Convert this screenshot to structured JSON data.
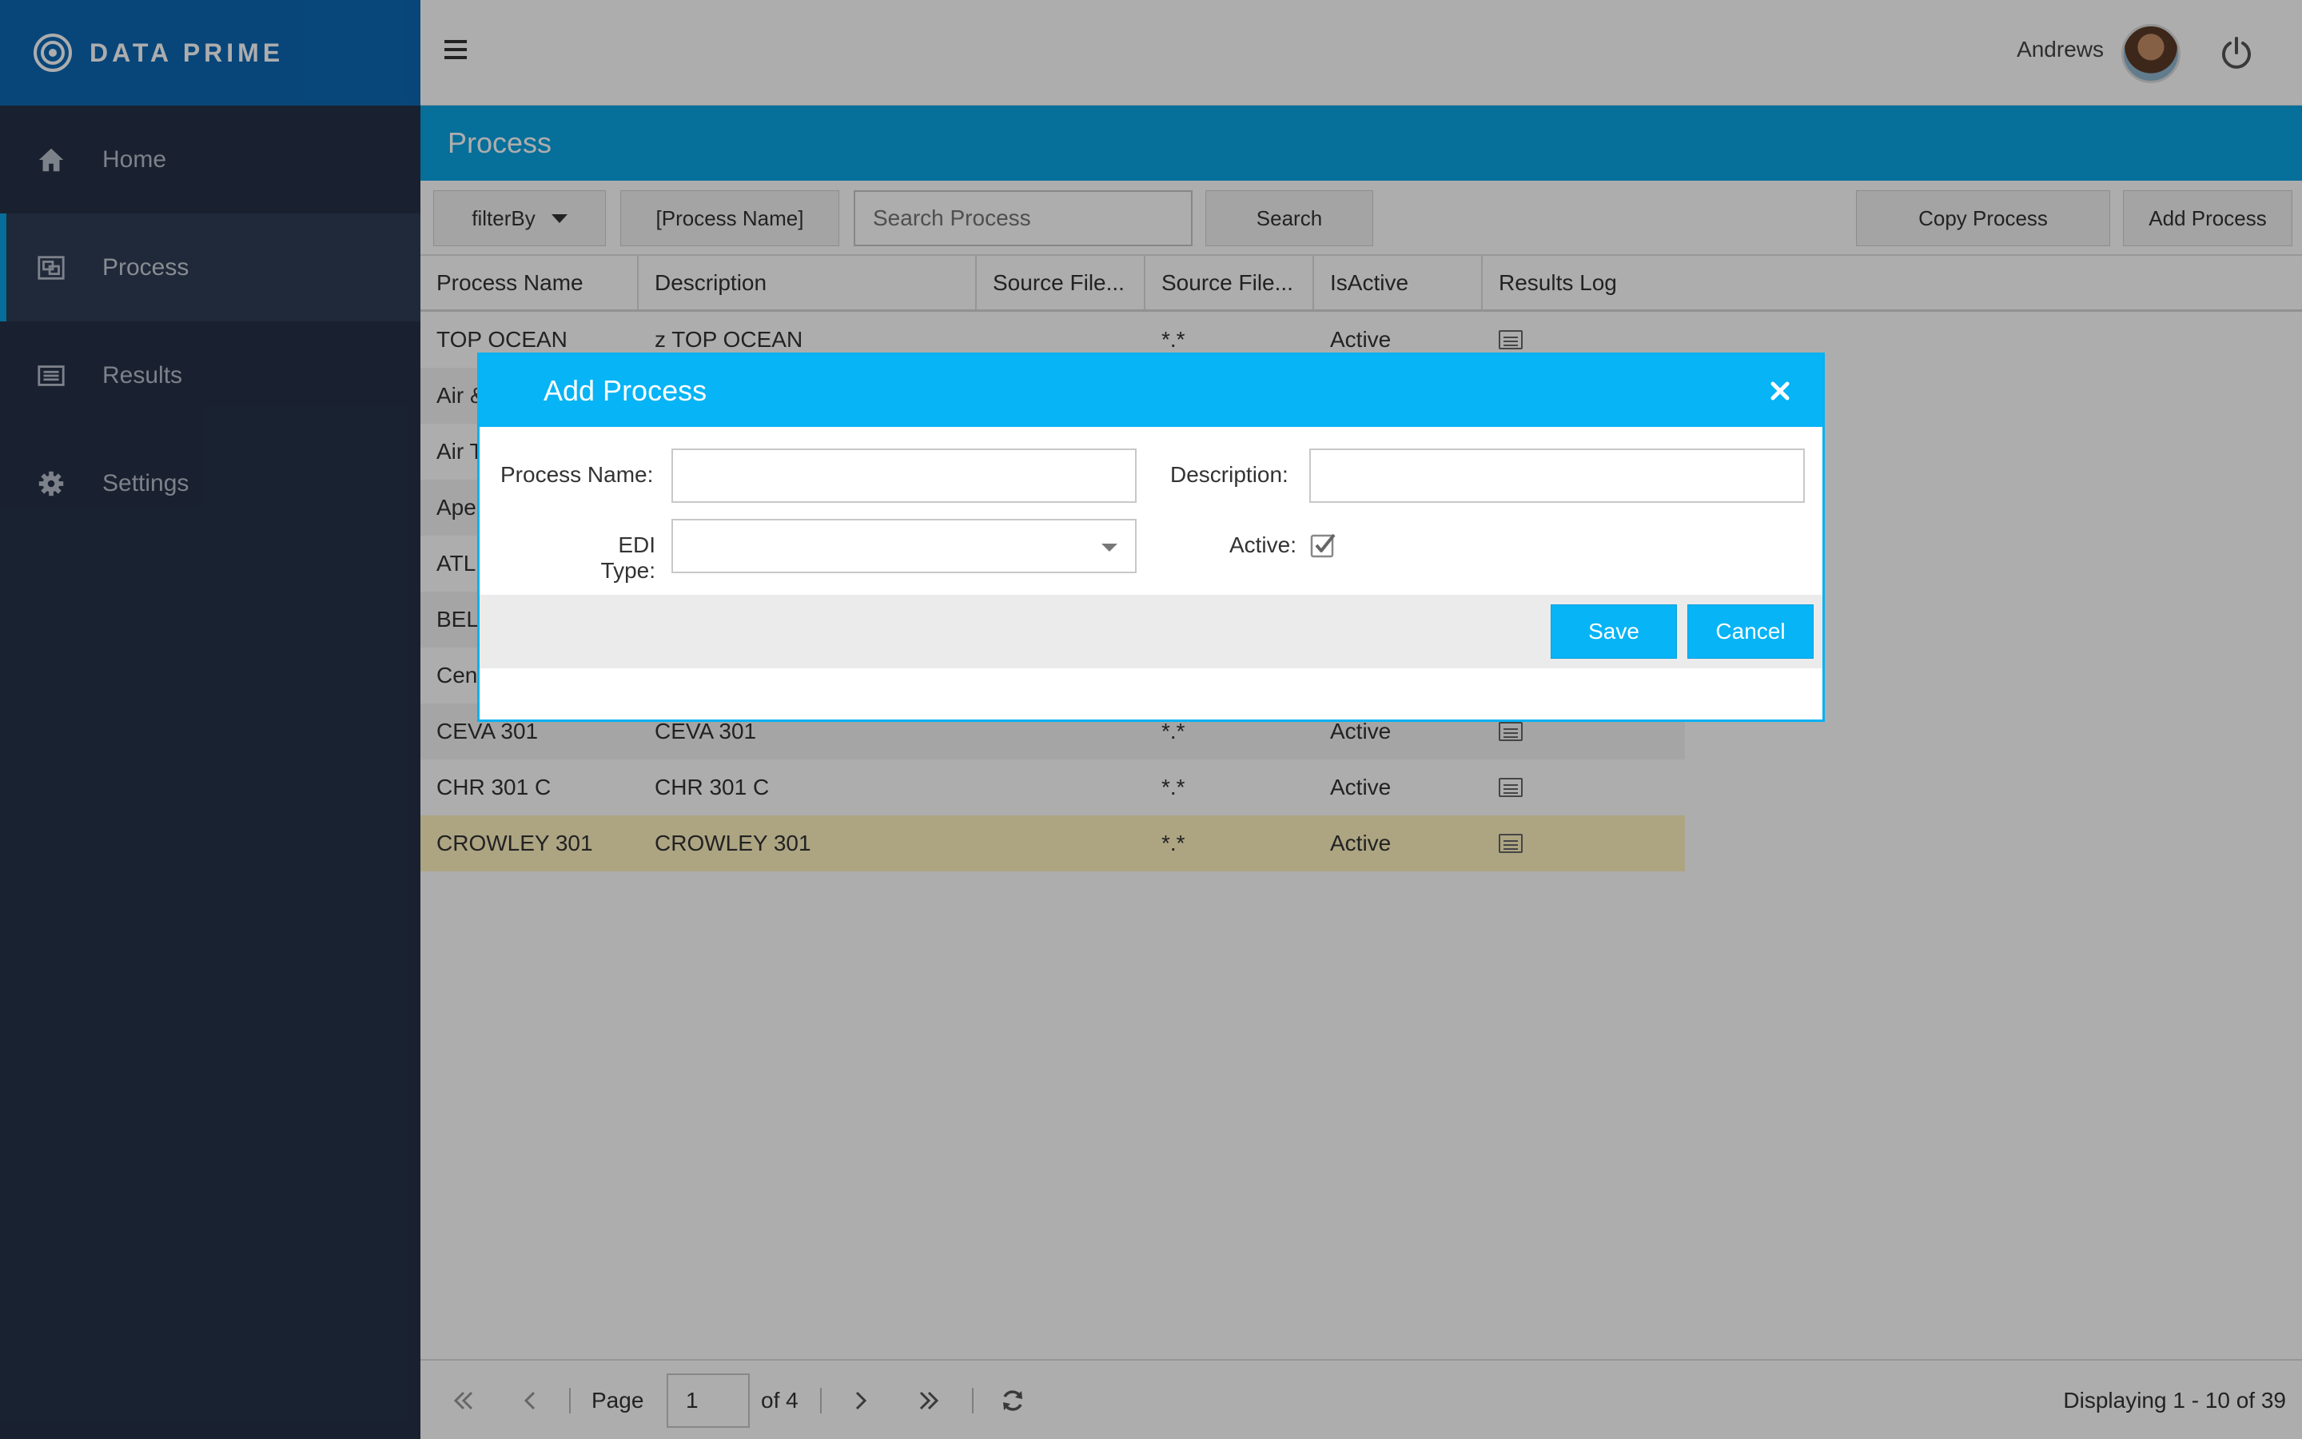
{
  "brand": {
    "name": "DATA PRIME"
  },
  "sidebar": {
    "items": [
      {
        "label": "Home",
        "icon": "home-icon"
      },
      {
        "label": "Process",
        "icon": "process-icon",
        "active": true
      },
      {
        "label": "Results",
        "icon": "results-icon"
      },
      {
        "label": "Settings",
        "icon": "gear-icon"
      }
    ]
  },
  "topbar": {
    "username": "Andrews"
  },
  "page": {
    "title": "Process"
  },
  "toolbar": {
    "filter_label": "filterBy",
    "field_label": "[Process Name]",
    "search_placeholder": "Search Process",
    "search_button": "Search",
    "copy_button": "Copy Process",
    "add_button": "Add Process"
  },
  "grid": {
    "columns": [
      "Process Name",
      "Description",
      "Source File...",
      "Source File...",
      "IsActive",
      "Results Log"
    ],
    "rows": [
      {
        "name": "TOP OCEAN",
        "description": "z TOP OCEAN",
        "source2": "*.*",
        "active": "Active"
      },
      {
        "name": "Air &",
        "description": "",
        "source2": "",
        "active": ""
      },
      {
        "name": "Air T",
        "description": "",
        "source2": "",
        "active": ""
      },
      {
        "name": "Ape",
        "description": "",
        "source2": "",
        "active": ""
      },
      {
        "name": "ATL",
        "description": "",
        "source2": "",
        "active": ""
      },
      {
        "name": "BEL",
        "description": "",
        "source2": "",
        "active": ""
      },
      {
        "name": "Cen",
        "description": "",
        "source2": "",
        "active": ""
      },
      {
        "name": "CEVA 301",
        "description": "CEVA 301",
        "source2": "*.*",
        "active": "Active"
      },
      {
        "name": "CHR 301 C",
        "description": "CHR 301 C",
        "source2": "*.*",
        "active": "Active"
      },
      {
        "name": "CROWLEY 301",
        "description": "CROWLEY 301",
        "source2": "*.*",
        "active": "Active"
      }
    ]
  },
  "pager": {
    "page_label": "Page",
    "page_value": "1",
    "of_label": "of 4",
    "display_text": "Displaying 1 - 10 of 39"
  },
  "modal": {
    "title": "Add Process",
    "process_name_label": "Process Name:",
    "description_label": "Description:",
    "edi_type_label": "EDI Type:",
    "active_label": "Active:",
    "active_checked": true,
    "save_label": "Save",
    "cancel_label": "Cancel"
  },
  "colors": {
    "sidebar": "#253247",
    "brand": "#0c68b4",
    "accent": "#0aa4e4",
    "modal_header": "#07b4f5",
    "selected_row": "#fff3c0"
  }
}
